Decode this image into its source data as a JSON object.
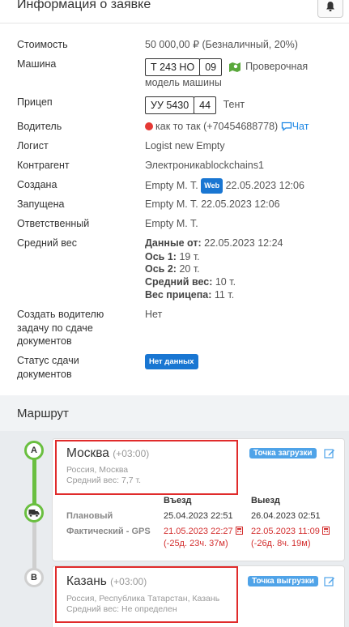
{
  "info": {
    "title": "Информация о заявке",
    "rows": {
      "cost_label": "Стоимость",
      "cost_value": "50 000,00 ₽ (Безналичный, 20%)",
      "truck_label": "Машина",
      "truck_plate": "Т 243 НО",
      "truck_region": "09",
      "truck_model_1": "Проверочная",
      "truck_model_2": "модель машины",
      "trailer_label": "Прицеп",
      "trailer_plate": "УУ 5430",
      "trailer_region": "44",
      "trailer_type": "Тент",
      "driver_label": "Водитель",
      "driver_value": "как то так (+70454688778)",
      "driver_chat": "Чат",
      "logist_label": "Логист",
      "logist_value": "Logist new Empty",
      "contractor_label": "Контрагент",
      "contractor_value": "Электроникаblockchains1",
      "created_label": "Создана",
      "created_by": "Empty M. T.",
      "created_badge": "Web",
      "created_at": "22.05.2023 12:06",
      "launched_label": "Запущена",
      "launched_value": "Empty M. T. 22.05.2023 12:06",
      "responsible_label": "Ответственный",
      "responsible_value": "Empty M. T.",
      "avg_weight_label": "Средний вес",
      "w_data_key": "Данные от:",
      "w_data_val": "22.05.2023 12:24",
      "w_axle1_key": "Ось 1:",
      "w_axle1_val": "19 т.",
      "w_axle2_key": "Ось 2:",
      "w_axle2_val": "20 т.",
      "w_avg_key": "Средний вес:",
      "w_avg_val": "10 т.",
      "w_trailer_key": "Вес прицепа:",
      "w_trailer_val": "11 т.",
      "task_label_1": "Создать водителю",
      "task_label_2": "задачу по сдаче",
      "task_label_3": "документов",
      "task_value": "Нет",
      "docs_label_1": "Статус сдачи",
      "docs_label_2": "документов",
      "docs_badge": "Нет данных"
    }
  },
  "route": {
    "title": "Маршрут",
    "point_a": {
      "marker": "A",
      "city": "Москва",
      "tz": "(+03:00)",
      "address": "Россия, Москва",
      "avg_weight": "Средний вес: 7,7 т.",
      "tag": "Точка загрузки"
    },
    "times": {
      "entry_header": "Въезд",
      "exit_header": "Выезд",
      "planned_label": "Плановый",
      "planned_entry": "25.04.2023 22:51",
      "planned_exit": "26.04.2023 02:51",
      "actual_label": "Фактический - GPS",
      "actual_entry": "21.05.2023 22:27",
      "actual_entry_diff": "(-25д. 23ч. 37м)",
      "actual_exit": "22.05.2023 11:09",
      "actual_exit_diff": "(-26д. 8ч. 19м)"
    },
    "point_b": {
      "marker": "B",
      "city": "Казань",
      "tz": "(+03:00)",
      "address": "Россия, Республика Татарстан, Казань",
      "avg_weight": "Средний вес: Не определен",
      "tag": "Точка выгрузки"
    }
  },
  "colors": {
    "accent": "#1976d2",
    "tag": "#4fa3e8",
    "highlight": "#e02b2b",
    "green": "#6abf40",
    "late": "#d32f2f"
  }
}
